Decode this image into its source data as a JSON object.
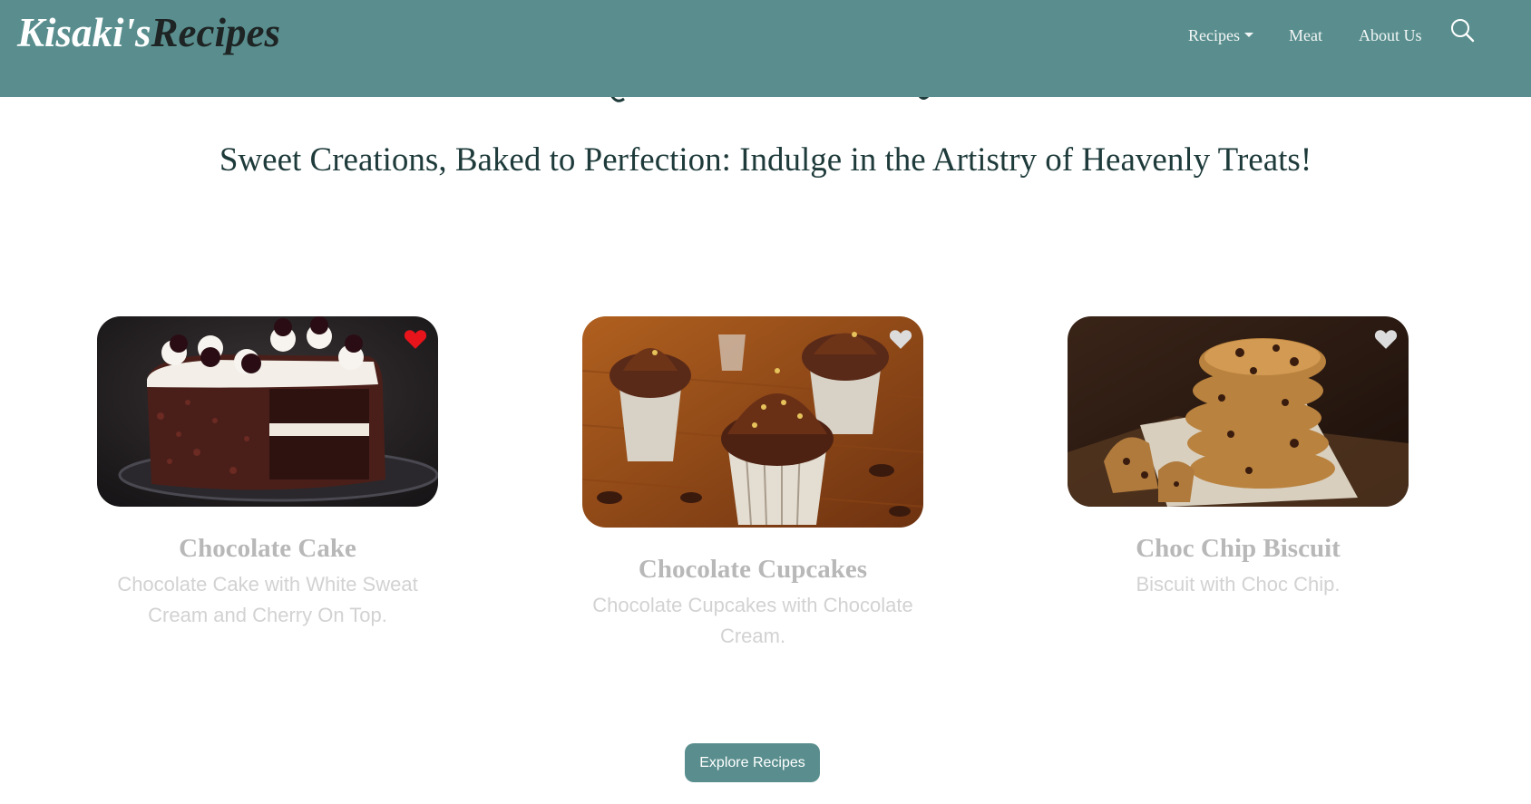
{
  "brand": {
    "part1": "Kisaki's",
    "part2": "Recipes"
  },
  "nav": {
    "recipes": "Recipes",
    "meat": "Meat",
    "about": "About Us",
    "search_icon": "search-icon"
  },
  "hero": {
    "tagline": "Sweet Creations, Baked to Perfection: Indulge in the Artistry of Heavenly Treats!"
  },
  "cards": [
    {
      "title": "Chocolate Cake",
      "description": "Chocolate Cake with White Sweat Cream and Cherry On Top.",
      "favorited": true,
      "heart_color": "#e8141b"
    },
    {
      "title": "Chocolate Cupcakes",
      "description": "Chocolate Cupcakes with Chocolate Cream.",
      "favorited": false,
      "heart_color": "#dcdcdc"
    },
    {
      "title": "Choc Chip Biscuit",
      "description": "Biscuit with Choc Chip.",
      "favorited": false,
      "heart_color": "#dcdcdc"
    }
  ],
  "cta": {
    "label": "Explore Recipes"
  },
  "colors": {
    "primary": "#5a8e8e",
    "heading": "#1e3a3a",
    "card_title": "#b8b8b8",
    "card_desc": "#d2d2d2"
  }
}
